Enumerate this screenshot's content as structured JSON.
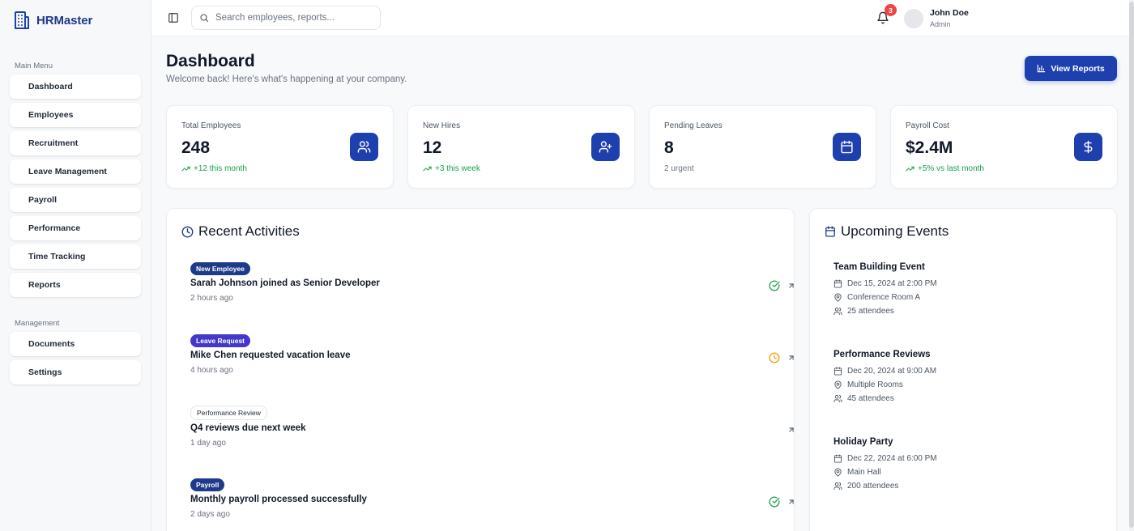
{
  "brand": {
    "name": "HRMaster"
  },
  "sidebar": {
    "main_menu_label": "Main Menu",
    "main_items": [
      {
        "label": "Dashboard"
      },
      {
        "label": "Employees"
      },
      {
        "label": "Recruitment"
      },
      {
        "label": "Leave Management"
      },
      {
        "label": "Payroll"
      },
      {
        "label": "Performance"
      },
      {
        "label": "Time Tracking"
      },
      {
        "label": "Reports"
      }
    ],
    "management_label": "Management",
    "management_items": [
      {
        "label": "Documents"
      },
      {
        "label": "Settings"
      }
    ]
  },
  "topbar": {
    "search_placeholder": "Search employees, reports...",
    "notification_count": "3",
    "user": {
      "name": "John Doe",
      "role": "Admin"
    }
  },
  "header": {
    "title": "Dashboard",
    "subtitle": "Welcome back! Here's what's happening at your company.",
    "view_reports_label": "View Reports"
  },
  "stats": [
    {
      "label": "Total Employees",
      "value": "248",
      "trend": "+12 this month",
      "trend_up": true,
      "icon": "users-icon"
    },
    {
      "label": "New Hires",
      "value": "12",
      "trend": "+3 this week",
      "trend_up": true,
      "icon": "user-plus-icon"
    },
    {
      "label": "Pending Leaves",
      "value": "8",
      "trend": "2 urgent",
      "trend_up": false,
      "icon": "calendar-icon"
    },
    {
      "label": "Payroll Cost",
      "value": "$2.4M",
      "trend": "+5% vs last month",
      "trend_up": true,
      "icon": "dollar-icon"
    }
  ],
  "recent_activities": {
    "title": "Recent Activities",
    "items": [
      {
        "tag": "New Employee",
        "text": "Sarah Johnson joined as Senior Developer",
        "time": "2 hours ago",
        "status": "check-circle-icon"
      },
      {
        "tag": "Leave Request",
        "text": "Mike Chen requested vacation leave",
        "time": "4 hours ago",
        "status": "clock-icon"
      },
      {
        "tag": "Performance Review",
        "text": "Q4 reviews due next week",
        "time": "1 day ago",
        "status": ""
      },
      {
        "tag": "Payroll",
        "text": "Monthly payroll processed successfully",
        "time": "2 days ago",
        "status": "check-circle-icon"
      }
    ]
  },
  "upcoming_events": {
    "title": "Upcoming Events",
    "items": [
      {
        "title": "Team Building Event",
        "date": "Dec 15, 2024 at 2:00 PM",
        "location": "Conference Room A",
        "attendees": "25 attendees"
      },
      {
        "title": "Performance Reviews",
        "date": "Dec 20, 2024 at 9:00 AM",
        "location": "Multiple Rooms",
        "attendees": "45 attendees"
      },
      {
        "title": "Holiday Party",
        "date": "Dec 22, 2024 at 6:00 PM",
        "location": "Main Hall",
        "attendees": "200 attendees"
      }
    ]
  },
  "colors": {
    "primary": "#1e40af",
    "brand_text": "#1e3a8a",
    "success": "#16a34a",
    "warning": "#f59e0b",
    "danger": "#ef4444"
  }
}
